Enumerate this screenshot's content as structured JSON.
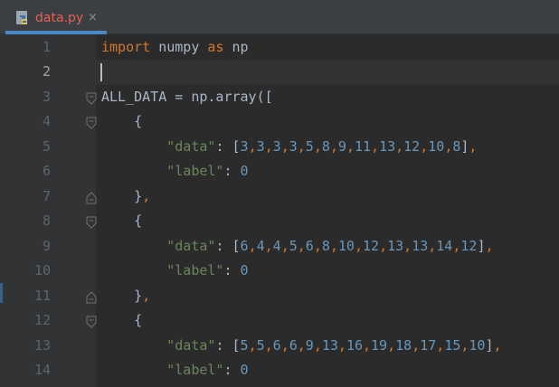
{
  "tab": {
    "filename": "data.py",
    "close": "×"
  },
  "lines": [
    {
      "n": "1"
    },
    {
      "n": "2"
    },
    {
      "n": "3"
    },
    {
      "n": "4"
    },
    {
      "n": "5"
    },
    {
      "n": "6"
    },
    {
      "n": "7"
    },
    {
      "n": "8"
    },
    {
      "n": "9"
    },
    {
      "n": "10"
    },
    {
      "n": "11"
    },
    {
      "n": "12"
    },
    {
      "n": "13"
    },
    {
      "n": "14"
    }
  ],
  "code": {
    "l1": {
      "import": "import",
      "module": " numpy ",
      "as": "as",
      "alias": " np"
    },
    "l3": {
      "text": "ALL_DATA = np.array(["
    },
    "l4": {
      "text": "    {"
    },
    "l5": {
      "key": "\"data\"",
      "colon": ": ",
      "open": "[",
      "values": [
        "3",
        "3",
        "3",
        "3",
        "5",
        "8",
        "9",
        "11",
        "13",
        "12",
        "10",
        "8"
      ],
      "close": "]",
      "comma": ","
    },
    "l6": {
      "key": "\"label\"",
      "colon": ": ",
      "value": "0"
    },
    "l7": {
      "brace": "    }",
      "comma": ","
    },
    "l8": {
      "text": "    {"
    },
    "l9": {
      "key": "\"data\"",
      "colon": ": ",
      "open": "[",
      "values": [
        "6",
        "4",
        "4",
        "5",
        "6",
        "8",
        "10",
        "12",
        "13",
        "13",
        "14",
        "12"
      ],
      "close": "]",
      "comma": ","
    },
    "l10": {
      "key": "\"label\"",
      "colon": ": ",
      "value": "0"
    },
    "l11": {
      "brace": "    }",
      "comma": ","
    },
    "l12": {
      "text": "    {"
    },
    "l13": {
      "key": "\"data\"",
      "colon": ": ",
      "open": "[",
      "values": [
        "5",
        "5",
        "6",
        "6",
        "9",
        "13",
        "16",
        "19",
        "18",
        "17",
        "15",
        "10"
      ],
      "close": "]",
      "comma": ","
    },
    "l14": {
      "key": "\"label\"",
      "colon": ": ",
      "value": "0"
    }
  },
  "colors": {
    "keyword": "#cc7832",
    "string": "#6a8759",
    "number": "#6897bb",
    "text": "#a9b7c6",
    "tab_label": "#e0625a",
    "tab_underline": "#4a88c7"
  },
  "current_line": "2"
}
